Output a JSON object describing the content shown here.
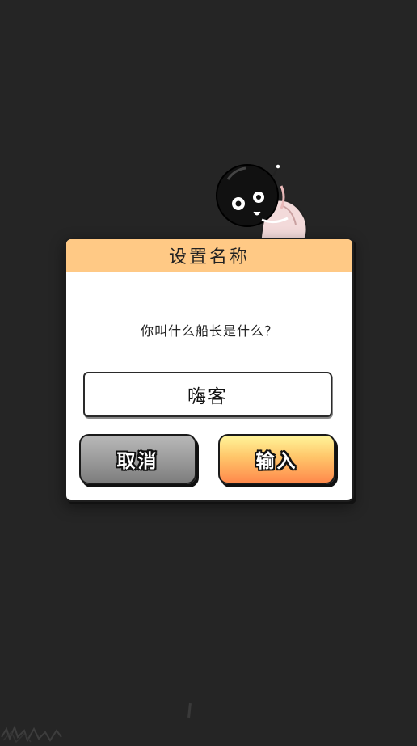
{
  "dialog": {
    "title": "设置名称",
    "message": "你叫什么船长是什么？",
    "input_value": "嗨客",
    "cancel_label": "取消",
    "confirm_label": "输入"
  },
  "colors": {
    "background": "#252525",
    "header": "#ffc985",
    "cancel_button": "#9b9b9b",
    "confirm_button": "#ffb45e"
  },
  "icons": {
    "mascot": "astronaut-mascot-icon"
  }
}
